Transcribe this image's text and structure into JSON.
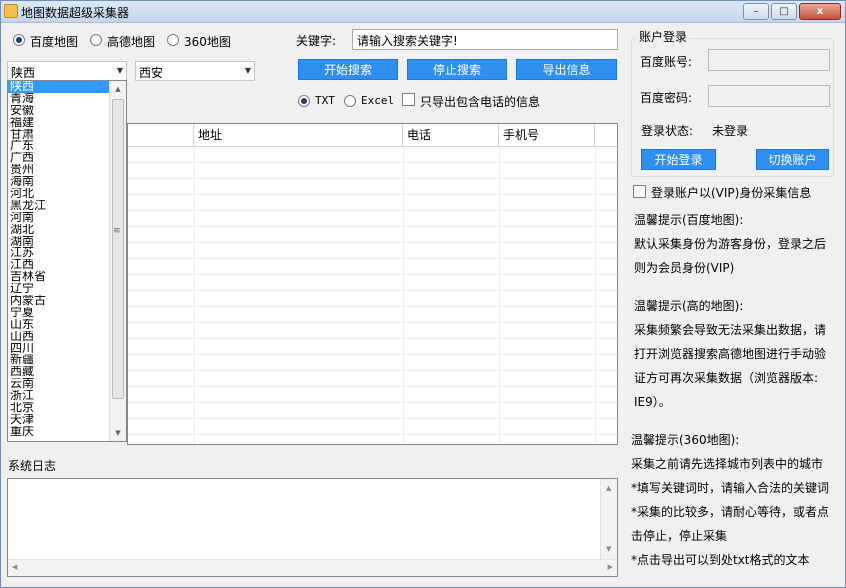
{
  "window": {
    "title": "地图数据超级采集器",
    "min_label": "–",
    "max_label": "□",
    "close_label": "x"
  },
  "map_source": {
    "options": [
      {
        "label": "百度地图",
        "selected": true
      },
      {
        "label": "高德地图",
        "selected": false
      },
      {
        "label": "360地图",
        "selected": false
      }
    ]
  },
  "province_select": {
    "value": "陕西"
  },
  "city_select": {
    "value": "西安"
  },
  "provinces": [
    "陕西",
    "青海",
    "安徽",
    "福建",
    "甘肃",
    "广东",
    "广西",
    "贵州",
    "海南",
    "河北",
    "黑龙江",
    "河南",
    "湖北",
    "湖南",
    "江苏",
    "江西",
    "吉林省",
    "辽宁",
    "内蒙古",
    "宁夏",
    "山东",
    "山西",
    "四川",
    "新疆",
    "西藏",
    "云南",
    "浙江",
    "北京",
    "天津",
    "重庆"
  ],
  "keyword": {
    "label": "关键字:",
    "value": "请输入搜索关键字!"
  },
  "buttons": {
    "start_search": "开始搜索",
    "stop_search": "停止搜索",
    "export": "导出信息"
  },
  "export_format": {
    "options": [
      {
        "label": "TXT",
        "selected": true
      },
      {
        "label": "Excel",
        "selected": false
      }
    ],
    "phone_only_label": "只导出包含电话的信息",
    "phone_only_checked": false
  },
  "table": {
    "columns": [
      "地址",
      "电话",
      "手机号"
    ],
    "rows": []
  },
  "account": {
    "legend": "账户登录",
    "account_label": "百度账号:",
    "account_value": "",
    "password_label": "百度密码:",
    "password_value": "",
    "status_label": "登录状态:",
    "status_value": "未登录",
    "login_button": "开始登录",
    "switch_button": "切换账户"
  },
  "vip": {
    "label": "登录账户以(VIP)身份采集信息",
    "checked": false
  },
  "tips": {
    "baidu_title": "温馨提示(百度地图):",
    "baidu_lines": [
      "默认采集身份为游客身份，登录之后",
      "则为会员身份(VIP)"
    ],
    "gaode_title": "温馨提示(高的地图):",
    "gaode_lines": [
      "采集频繁会导致无法采集出数据，请",
      "打开浏览器搜索高德地图进行手动验",
      "证方可再次采集数据（浏览器版本:",
      "IE9）。"
    ],
    "s360_title": "温馨提示(360地图):",
    "s360_lines": [
      "采集之前请先选择城市列表中的城市",
      "*填写关键词时，请输入合法的关键词",
      "*采集的比较多，请耐心等待，或者点",
      " 击停止，停止采集",
      "*点击导出可以到处txt格式的文本"
    ]
  },
  "log": {
    "label": "系统日志",
    "text": ""
  }
}
